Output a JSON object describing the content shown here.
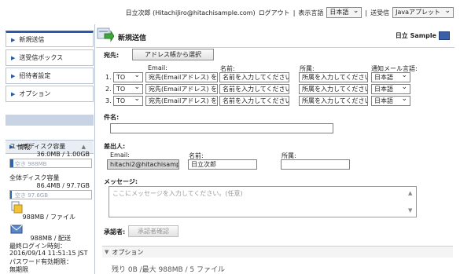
{
  "header": {
    "user": "日立次郎 (HitachiJiro@hitachisample.com)",
    "logout": "ログアウト",
    "lang_label": "表示言語",
    "lang_value": "日本語",
    "sender_label": "送受信",
    "sender_value": "Javaアプレット"
  },
  "sidebar": {
    "items": [
      {
        "label": "新規送信"
      },
      {
        "label": "送受信ボックス"
      },
      {
        "label": "招待者設定"
      },
      {
        "label": "オプション"
      }
    ],
    "info_label": "情報",
    "user_disk_label": "ユーザディスク容量",
    "user_disk_value": "36.0MB / 1.00GB",
    "user_disk_free": "空き 988MB",
    "user_disk_used_pct": 3.6,
    "all_disk_label": "全体ディスク容量",
    "all_disk_value": "86.4MB / 97.7GB",
    "all_disk_free": "空き 97.6GB",
    "all_disk_used_pct": 0.1,
    "per_file": "988MB / ファイル",
    "per_send": "988MB / 配送",
    "last_login_label": "最終ログイン時刻：",
    "last_login_value": "2016/09/14 11:51:15 JST",
    "pw_expiry_label": "パスワード有効期限：",
    "pw_expiry_value": "無期限"
  },
  "main": {
    "title": "新規送信",
    "brand": "日立 Sample",
    "to_label": "宛先:",
    "address_button": "アドレス帳から選択",
    "col_email": "Email:",
    "col_name": "名前:",
    "col_org": "所属:",
    "col_lang": "通知メール言語:",
    "rows": [
      {
        "num": "1.",
        "type": "TO",
        "email": "宛先(Emailアドレス) を入力",
        "name": "名前を入力してください。",
        "org": "所属を入力してください。",
        "lang": "日本語"
      },
      {
        "num": "2.",
        "type": "TO",
        "email": "宛先(Emailアドレス) を入力",
        "name": "名前を入力してください。",
        "org": "所属を入力してください。",
        "lang": "日本語"
      },
      {
        "num": "3.",
        "type": "TO",
        "email": "宛先(Emailアドレス) を入力",
        "name": "名前を入力してください。",
        "org": "所属を入力してください。",
        "lang": "日本語"
      }
    ],
    "subject_label": "件名:",
    "sender_label": "差出人:",
    "sender_email_label": "Email:",
    "sender_email": "hitachi2@hitachisample",
    "sender_name_label": "名前:",
    "sender_name": "日立次郎",
    "sender_org_label": "所属:",
    "message_label": "メッセージ:",
    "message_placeholder": "ここにメッセージを入力してください。(任意)",
    "approver_label": "承認者:",
    "approver_button": "承認者確認",
    "options_label": "オプション",
    "bottom_text": "残り 0B /最大 988MB / 5 ファイル"
  }
}
